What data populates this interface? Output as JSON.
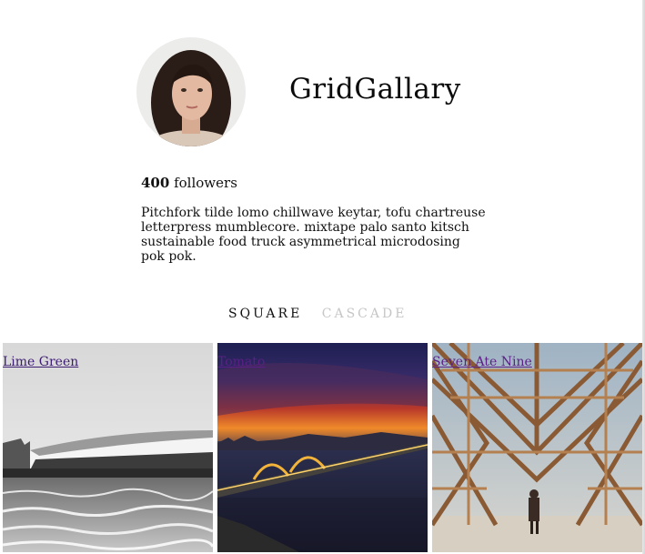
{
  "profile": {
    "brand_name": "GridGallary",
    "followers_count": "400",
    "followers_label": "followers",
    "bio": "Pitchfork tilde lomo chillwave keytar, tofu chartreuse letterpress mumblecore. mixtape palo santo kitsch sustainable food truck asymmetrical microdosing pok pok."
  },
  "view_tabs": {
    "square_label": "SQUARE",
    "cascade_label": "CASCADE",
    "active": "SQUARE"
  },
  "gallery": {
    "tiles": [
      {
        "caption": "Lime Green",
        "image": "black-and-white-waterfront-building-photo"
      },
      {
        "caption": "Tomato",
        "image": "city-bridge-at-sunset-photo"
      },
      {
        "caption": "Seven Ate Nine",
        "image": "wooden-lattice-sculpture-desert-photo"
      }
    ]
  },
  "colors": {
    "link": "#5b1f86",
    "inactive_tab": "#c6c6c6",
    "text": "#111111"
  }
}
